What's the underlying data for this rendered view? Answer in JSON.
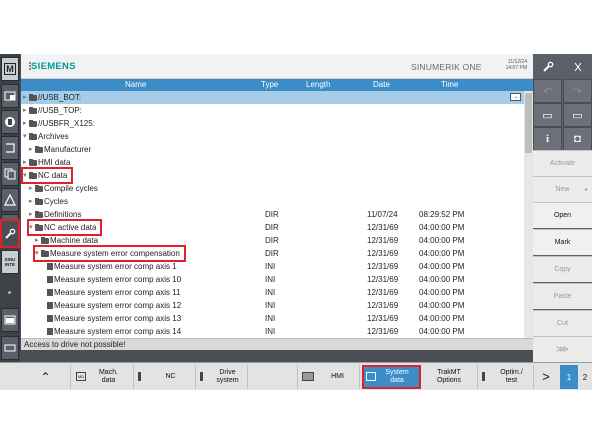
{
  "header": {
    "brand": "SIEMENS",
    "product": "SINUMERIK ONE",
    "date": "11/12/24",
    "time": "14:07 PM"
  },
  "columns": {
    "name": "Name",
    "type": "Type",
    "length": "Length",
    "date": "Date",
    "time": "Time"
  },
  "rows": [
    {
      "name": "//USB_BOT:",
      "type": "",
      "date": "",
      "time": "",
      "selected": true
    },
    {
      "name": "//USB_TOP:",
      "type": "",
      "date": "",
      "time": ""
    },
    {
      "name": "//USBFR_X125:",
      "type": "",
      "date": "",
      "time": ""
    },
    {
      "name": "Archives",
      "type": "",
      "date": "",
      "time": ""
    },
    {
      "name": "Manufacturer",
      "type": "",
      "date": "",
      "time": ""
    },
    {
      "name": "HMI data",
      "type": "",
      "date": "",
      "time": ""
    },
    {
      "name": "NC data",
      "type": "",
      "date": "",
      "time": "",
      "highlight": true
    },
    {
      "name": "Compile cycles",
      "type": "",
      "date": "",
      "time": ""
    },
    {
      "name": "Cycles",
      "type": "",
      "date": "",
      "time": ""
    },
    {
      "name": "Definitions",
      "type": "DIR",
      "date": "11/07/24",
      "time": "08:29:52 PM"
    },
    {
      "name": "NC active data",
      "type": "DIR",
      "date": "12/31/69",
      "time": "04:00:00 PM",
      "highlight": true
    },
    {
      "name": "Machine data",
      "type": "DIR",
      "date": "12/31/69",
      "time": "04:00:00 PM"
    },
    {
      "name": "Measure system error compensation",
      "type": "DIR",
      "date": "12/31/69",
      "time": "04:00:00 PM",
      "highlight": true
    },
    {
      "name": "Measure system error comp axis 1",
      "type": "INI",
      "date": "12/31/69",
      "time": "04:00:00 PM"
    },
    {
      "name": "Measure system error comp axis 10",
      "type": "INI",
      "date": "12/31/69",
      "time": "04:00:00 PM"
    },
    {
      "name": "Measure system error comp axis 11",
      "type": "INI",
      "date": "12/31/69",
      "time": "04:00:00 PM"
    },
    {
      "name": "Measure system error comp axis 12",
      "type": "INI",
      "date": "12/31/69",
      "time": "04:00:00 PM"
    },
    {
      "name": "Measure system error comp axis 13",
      "type": "INI",
      "date": "12/31/69",
      "time": "04:00:00 PM"
    },
    {
      "name": "Measure system error comp axis 14",
      "type": "INI",
      "date": "12/31/69",
      "time": "04:00:00 PM"
    }
  ],
  "status": "Access to drive not possible!",
  "vertical_softkeys": {
    "activate": "Activate",
    "new": "New",
    "open": "Open",
    "mark": "Mark",
    "copy": "Copy",
    "paste": "Paste",
    "cut": "Cut"
  },
  "horizontal_softkeys": {
    "mach_data": "Mach.\ndata",
    "nc": "NC",
    "drive_system": "Drive\nsystem",
    "hmi": "HMI",
    "system_data": "System\ndata",
    "trakmt": "TrakMT\nOptions",
    "optim_test": "Optim./\ntest",
    "page1": "1",
    "page2": "2"
  },
  "left_icons": {
    "machine": "M",
    "sinumerik_integrate": "SINU INTE"
  },
  "colors": {
    "accent": "#3c8cc7",
    "brand": "#009999",
    "highlight": "#e0202a"
  }
}
